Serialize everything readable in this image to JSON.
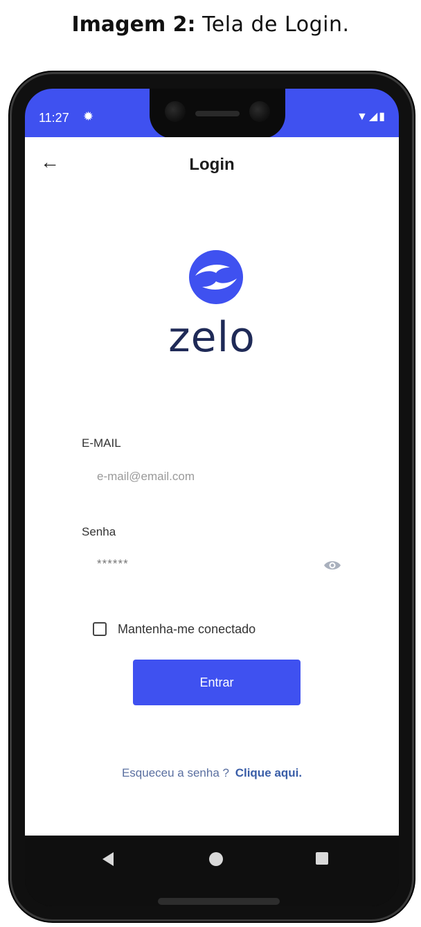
{
  "caption": {
    "strong": "Imagem 2:",
    "rest": "Tela de Login."
  },
  "status_bar": {
    "time": "11:27",
    "color": "#3f51f0",
    "icons": [
      "settings-icon",
      "wifi-icon",
      "signal-icon",
      "battery-icon"
    ]
  },
  "header": {
    "title": "Login",
    "back_icon": "back-arrow-icon"
  },
  "logo": {
    "text": "zelo",
    "mark_color": "#3f51f0",
    "text_color": "#1f2a57"
  },
  "form": {
    "email_label": "E-MAIL",
    "email_placeholder": "e-mail@email.com",
    "password_label": "Senha",
    "password_value": "******",
    "remember_label": "Mantenha-me conectado",
    "remember_checked": false,
    "submit_label": "Entrar"
  },
  "forgot": {
    "text": "Esqueceu a senha ?",
    "link": "Clique aqui."
  },
  "nav_bar": {
    "buttons": [
      "back-icon",
      "home-icon",
      "recent-apps-icon"
    ]
  }
}
